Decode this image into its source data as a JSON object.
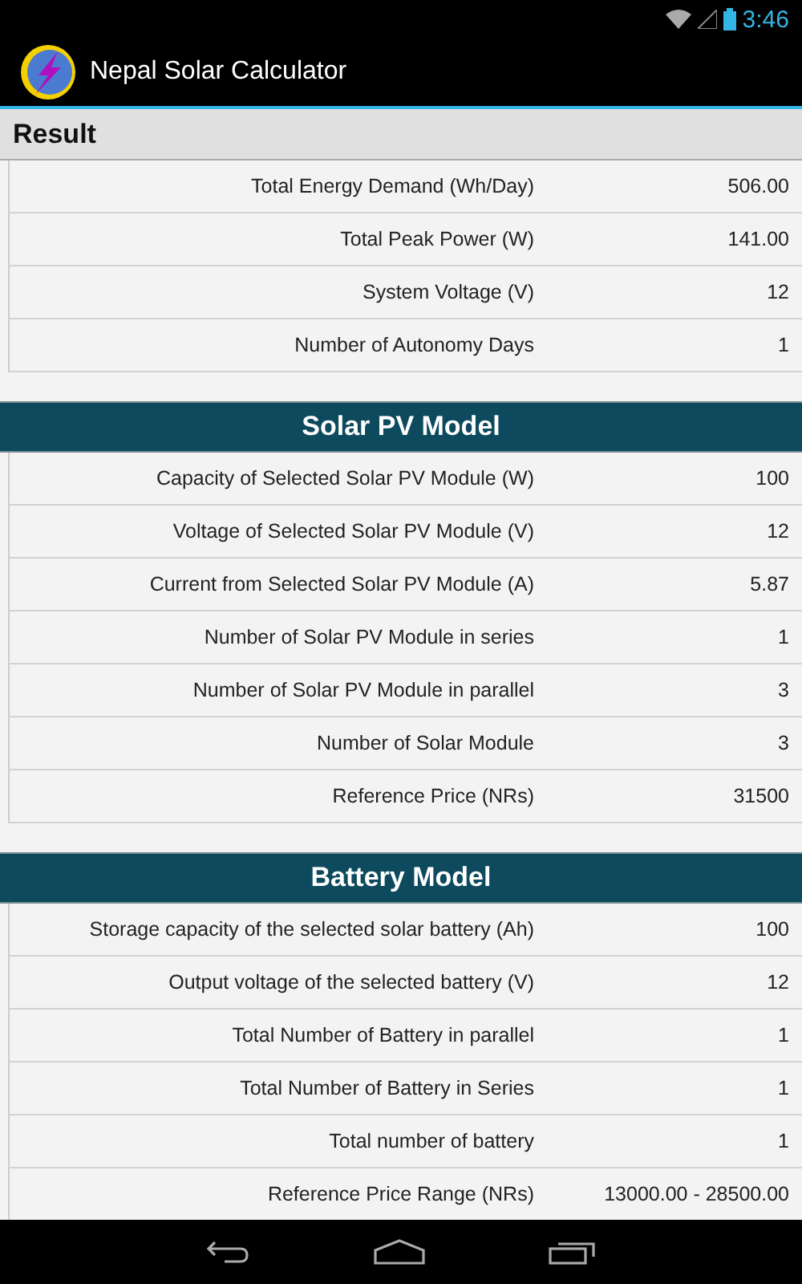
{
  "status_bar": {
    "time": "3:46"
  },
  "app_bar": {
    "title": "Nepal Solar Calculator"
  },
  "sections": [
    {
      "kind": "plain",
      "title": "Result",
      "rows": [
        {
          "label": "Total Energy Demand (Wh/Day)",
          "value": "506.00"
        },
        {
          "label": "Total Peak Power (W)",
          "value": "141.00"
        },
        {
          "label": "System Voltage (V)",
          "value": "12"
        },
        {
          "label": "Number of Autonomy Days",
          "value": "1"
        }
      ]
    },
    {
      "kind": "banner",
      "title": "Solar PV Model",
      "rows": [
        {
          "label": "Capacity of Selected Solar PV Module (W)",
          "value": "100"
        },
        {
          "label": "Voltage of Selected Solar PV Module (V)",
          "value": "12"
        },
        {
          "label": "Current from Selected Solar PV Module (A)",
          "value": "5.87"
        },
        {
          "label": "Number of Solar PV Module in series",
          "value": "1"
        },
        {
          "label": "Number of Solar PV Module in parallel",
          "value": "3"
        },
        {
          "label": "Number of Solar Module",
          "value": "3"
        },
        {
          "label": "Reference Price (NRs)",
          "value": "31500"
        }
      ]
    },
    {
      "kind": "banner",
      "title": "Battery Model",
      "rows": [
        {
          "label": "Storage capacity of the selected solar battery (Ah)",
          "value": "100"
        },
        {
          "label": "Output voltage of the selected battery (V)",
          "value": "12"
        },
        {
          "label": "Total Number of Battery in parallel",
          "value": "1"
        },
        {
          "label": "Total Number of Battery in Series",
          "value": "1"
        },
        {
          "label": "Total number of battery",
          "value": "1"
        },
        {
          "label": "Reference Price Range (NRs)",
          "value": "13000.00 - 28500.00"
        }
      ]
    }
  ]
}
